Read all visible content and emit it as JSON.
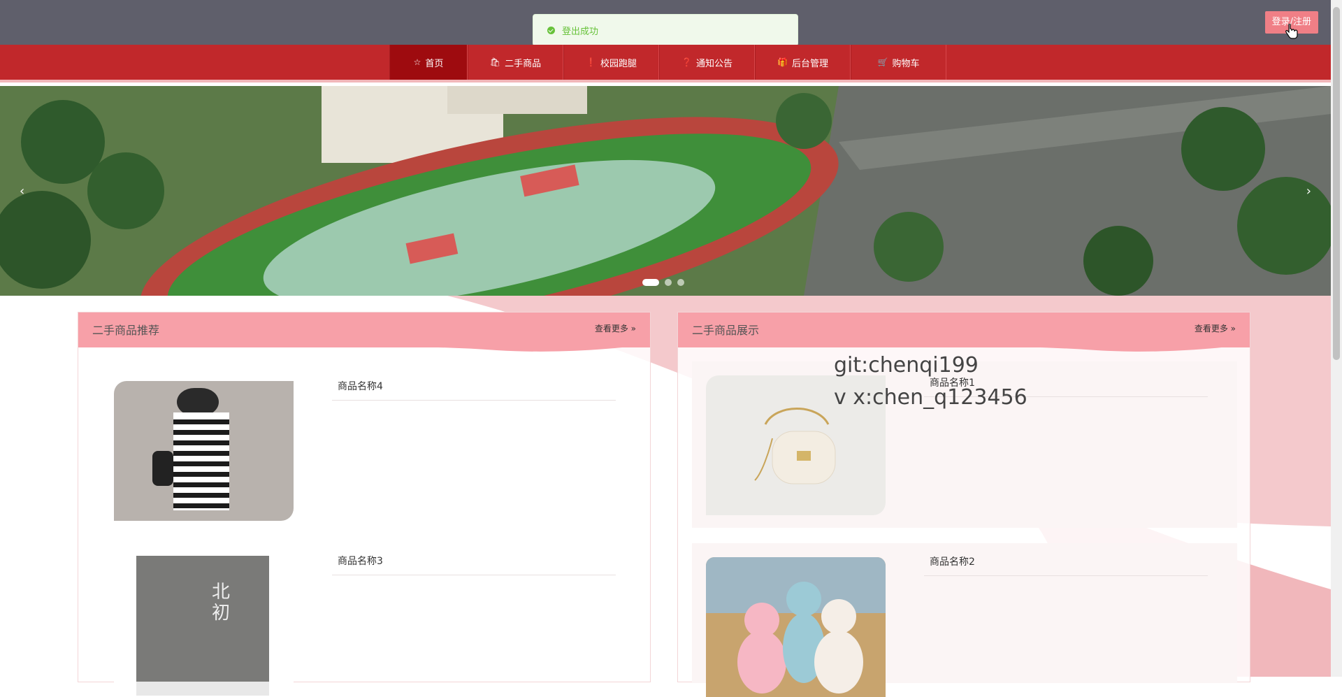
{
  "toast": {
    "message": "登出成功"
  },
  "header": {
    "login_label": "登录/注册"
  },
  "nav": {
    "items": [
      {
        "label": "首页",
        "icon": "star-icon",
        "active": true
      },
      {
        "label": "二手商品",
        "icon": "bag-icon"
      },
      {
        "label": "校园跑腿",
        "icon": "exclamation-icon"
      },
      {
        "label": "通知公告",
        "icon": "question-icon"
      },
      {
        "label": "后台管理",
        "icon": "gift-icon"
      },
      {
        "label": "购物车",
        "icon": "cart-icon"
      }
    ]
  },
  "banner": {
    "slide_count": 3,
    "active_index": 0
  },
  "panel_left": {
    "title": "二手商品推荐",
    "more": "查看更多",
    "products": [
      {
        "name": "商品名称4"
      },
      {
        "name": "商品名称3"
      }
    ]
  },
  "panel_right": {
    "title": "二手商品展示",
    "more": "查看更多",
    "products": [
      {
        "name": "商品名称1"
      },
      {
        "name": "商品名称2"
      }
    ]
  },
  "watermark": {
    "line1": "git:chenqi199",
    "line2": "v x:chen_q123456"
  },
  "colors": {
    "nav_bg": "#c1282b",
    "nav_active": "#9e0b0f",
    "panel_head": "#f7a0a8",
    "login_btn": "#f07f86"
  }
}
